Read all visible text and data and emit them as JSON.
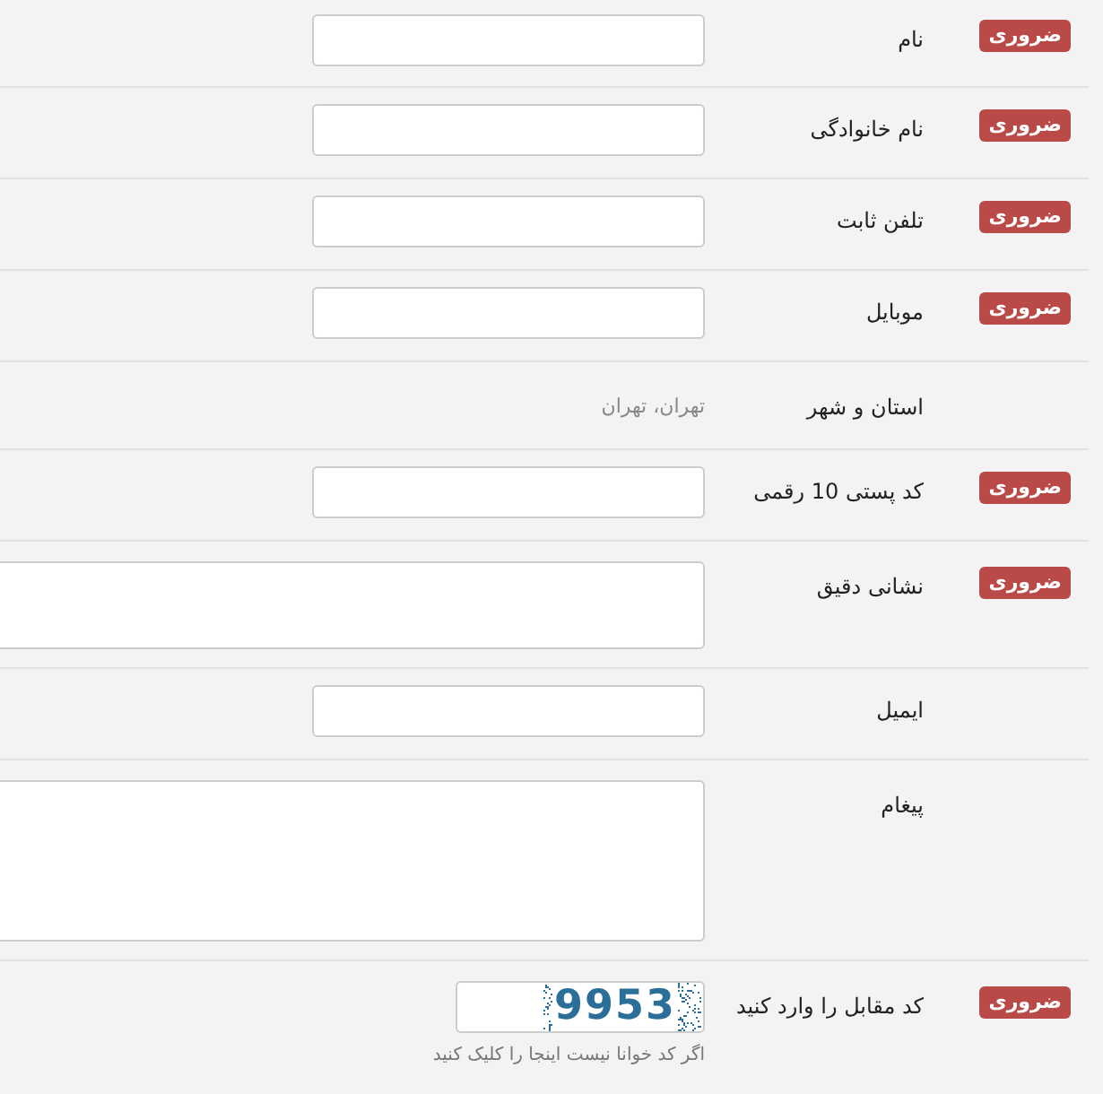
{
  "fields": [
    {
      "kind": "input",
      "label": "نام",
      "badge": "ضروری"
    },
    {
      "kind": "input",
      "label": "نام خانوادگی",
      "badge": "ضروری"
    },
    {
      "kind": "input",
      "label": "تلفن ثابت",
      "badge": "ضروری"
    },
    {
      "kind": "input",
      "label": "موبایل",
      "badge": "ضروری"
    },
    {
      "kind": "text",
      "label": "استان و شهر",
      "value": "تهران، تهران"
    },
    {
      "kind": "input",
      "label": "کد پستی 10 رقمی",
      "badge": "ضروری"
    },
    {
      "kind": "textarea",
      "label": "نشانی دقیق",
      "badge": "ضروری"
    },
    {
      "kind": "input",
      "label": "ایمیل"
    },
    {
      "kind": "memo",
      "label": "پیغام"
    },
    {
      "kind": "captcha",
      "label": "کد مقابل را وارد کنید",
      "badge": "ضروری",
      "code": "9953",
      "help": "اگر کد خوانا نیست اینجا را کلیک کنید"
    }
  ]
}
